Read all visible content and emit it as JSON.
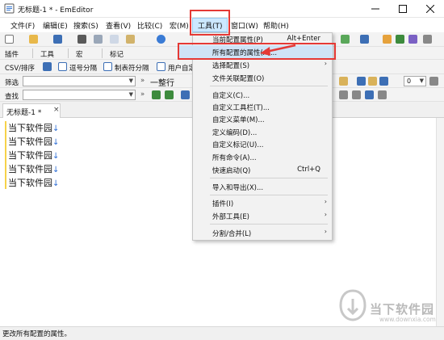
{
  "window": {
    "title": "无标题-1 * - EmEditor"
  },
  "menubar": {
    "items": [
      {
        "label": "文件(F)"
      },
      {
        "label": "编辑(E)"
      },
      {
        "label": "搜索(S)"
      },
      {
        "label": "查看(V)"
      },
      {
        "label": "比较(C)"
      },
      {
        "label": "宏(M)"
      },
      {
        "label": "工具(T)"
      },
      {
        "label": "窗口(W)"
      },
      {
        "label": "帮助(H)"
      }
    ]
  },
  "toolbar2": {
    "plugins": "插件",
    "tools": "工具",
    "macros": "宏",
    "marks": "标记"
  },
  "toolbar3": {
    "csv": "CSV/排序",
    "comma": "逗号分隔",
    "tab": "制表符分隔",
    "user": "用户自定"
  },
  "toolbar4": {
    "filter_label": "筛选",
    "filter_value": "",
    "line_label": "一整行",
    "page_value": "0"
  },
  "toolbar5": {
    "find_label": "查找",
    "find_value": ""
  },
  "tab": {
    "label": "无标题-1 *"
  },
  "editor": {
    "lines": [
      "当下软件园",
      "当下软件园",
      "当下软件园",
      "当下软件园",
      "当下软件园"
    ],
    "eol_mark": "↓"
  },
  "status": {
    "text": "更改所有配置的属性。"
  },
  "dropdown": {
    "items": [
      {
        "label": "当前配置属性(P)",
        "shortcut": "Alt+Enter"
      },
      {
        "label": "所有配置的属性(A)..."
      },
      {
        "label": "选择配置(S)",
        "submenu": "›"
      },
      {
        "label": "文件关联配置(O)"
      },
      {
        "label": "自定义(C)..."
      },
      {
        "label": "自定义工具栏(T)..."
      },
      {
        "label": "自定义菜单(M)..."
      },
      {
        "label": "定义编码(D)..."
      },
      {
        "label": "自定义标记(U)..."
      },
      {
        "label": "所有命令(A)..."
      },
      {
        "label": "快速启动(Q)",
        "shortcut": "Ctrl+Q"
      },
      {
        "label": "导入和导出(X)..."
      },
      {
        "label": "插件(I)",
        "submenu": "›"
      },
      {
        "label": "外部工具(E)",
        "submenu": "›"
      },
      {
        "label": "分割/合并(L)",
        "submenu": "›"
      }
    ]
  },
  "watermark": {
    "text": "当下软件园",
    "url": "www.downxia.com"
  },
  "colors": {
    "highlight_box": "#e53935",
    "menu_highlight": "#cce8ff",
    "gutter": "#f7d24a",
    "eol": "#2f6fd6"
  }
}
